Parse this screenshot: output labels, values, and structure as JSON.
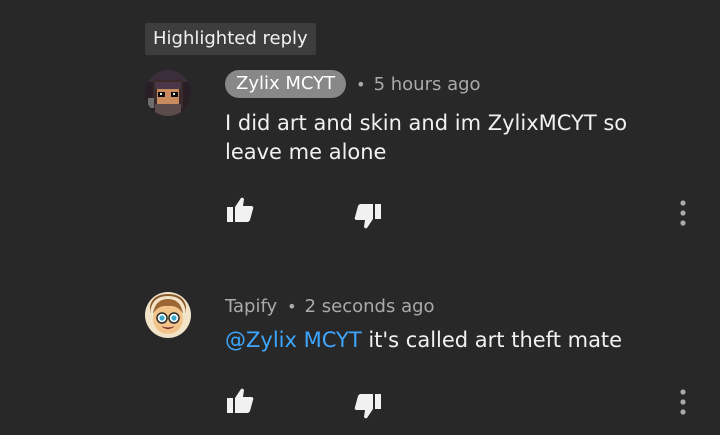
{
  "highlight": {
    "label": "Highlighted reply"
  },
  "comments": [
    {
      "author": "Zylix MCYT",
      "separator": "•",
      "time": "5 hours ago",
      "text": "I did art and skin and im ZylixMCYT so leave me alone"
    },
    {
      "author": "Tapify",
      "separator": "•",
      "time": "2 seconds ago",
      "mention": "@Zylix MCYT",
      "text": " it's called art theft mate"
    }
  ],
  "icons": {
    "like": "thumbs-up-icon",
    "dislike": "thumbs-down-icon",
    "more": "more-vertical-icon"
  },
  "colors": {
    "background": "#282828",
    "text": "#f1f1f1",
    "secondary_text": "#aaaaaa",
    "author_chip": "#888888",
    "mention": "#3ea6ff"
  }
}
